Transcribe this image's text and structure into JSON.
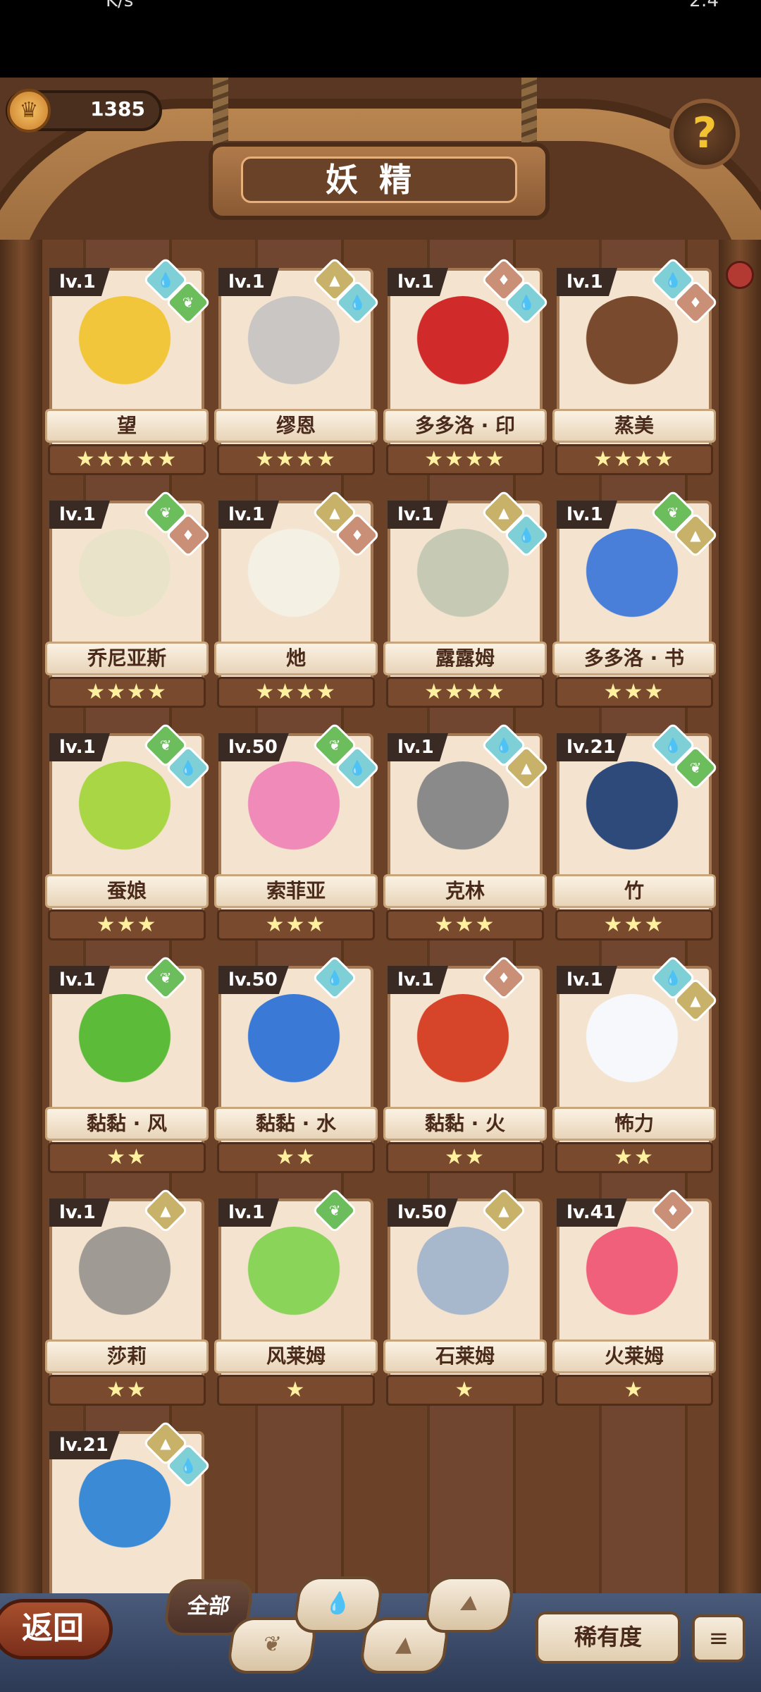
{
  "status": {
    "left": "K/s",
    "right": "2:4"
  },
  "header": {
    "coins": "1385",
    "title": "妖精",
    "help": "?"
  },
  "cards": [
    {
      "lv": "lv.1",
      "name": "望",
      "stars": "★★★★★",
      "elements": [
        "water",
        "wind"
      ],
      "color": "#f2c63b"
    },
    {
      "lv": "lv.1",
      "name": "缪恩",
      "stars": "★★★★",
      "elements": [
        "earth",
        "water"
      ],
      "color": "#c9c6c4"
    },
    {
      "lv": "lv.1",
      "name": "多多洛 · 印",
      "stars": "★★★★",
      "elements": [
        "fire",
        "water"
      ],
      "color": "#d12a2a"
    },
    {
      "lv": "lv.1",
      "name": "蒸美",
      "stars": "★★★★",
      "elements": [
        "water",
        "fire"
      ],
      "color": "#7a4a2e"
    },
    {
      "lv": "lv.1",
      "name": "乔尼亚斯",
      "stars": "★★★★",
      "elements": [
        "wind",
        "fire"
      ],
      "color": "#e9e3c9"
    },
    {
      "lv": "lv.1",
      "name": "灺",
      "stars": "★★★★",
      "elements": [
        "earth",
        "fire"
      ],
      "color": "#f4f0e4"
    },
    {
      "lv": "lv.1",
      "name": "露露姆",
      "stars": "★★★★",
      "elements": [
        "earth",
        "water"
      ],
      "color": "#c6cab4"
    },
    {
      "lv": "lv.1",
      "name": "多多洛 · 书",
      "stars": "★★★",
      "elements": [
        "wind",
        "earth"
      ],
      "color": "#4a7fd9"
    },
    {
      "lv": "lv.1",
      "name": "蚕娘",
      "stars": "★★★",
      "elements": [
        "wind",
        "water"
      ],
      "color": "#a9d645"
    },
    {
      "lv": "lv.50",
      "name": "索菲亚",
      "stars": "★★★",
      "elements": [
        "wind",
        "water"
      ],
      "color": "#f08ab8"
    },
    {
      "lv": "lv.1",
      "name": "克林",
      "stars": "★★★",
      "elements": [
        "water",
        "earth"
      ],
      "color": "#8a8a8a"
    },
    {
      "lv": "lv.21",
      "name": "竹",
      "stars": "★★★",
      "elements": [
        "water",
        "wind"
      ],
      "color": "#2d4a7a"
    },
    {
      "lv": "lv.1",
      "name": "黏黏 · 风",
      "stars": "★★",
      "elements": [
        "wind"
      ],
      "color": "#5cbc3a"
    },
    {
      "lv": "lv.50",
      "name": "黏黏 · 水",
      "stars": "★★",
      "elements": [
        "water"
      ],
      "color": "#3a7ad6"
    },
    {
      "lv": "lv.1",
      "name": "黏黏 · 火",
      "stars": "★★",
      "elements": [
        "fire"
      ],
      "color": "#d6442a"
    },
    {
      "lv": "lv.1",
      "name": "怖力",
      "stars": "★★",
      "elements": [
        "water",
        "earth"
      ],
      "color": "#f6f8fc"
    },
    {
      "lv": "lv.1",
      "name": "莎莉",
      "stars": "★★",
      "elements": [
        "earth"
      ],
      "color": "#a09a94"
    },
    {
      "lv": "lv.1",
      "name": "风莱姆",
      "stars": "★",
      "elements": [
        "wind"
      ],
      "color": "#8ad45a"
    },
    {
      "lv": "lv.50",
      "name": "石莱姆",
      "stars": "★",
      "elements": [
        "earth"
      ],
      "color": "#a8b8cc"
    },
    {
      "lv": "lv.41",
      "name": "火莱姆",
      "stars": "★",
      "elements": [
        "fire"
      ],
      "color": "#f0607a"
    },
    {
      "lv": "lv.21",
      "name": "",
      "stars": "",
      "elements": [
        "earth",
        "water"
      ],
      "color": "#3a8ad6"
    }
  ],
  "footer": {
    "back": "返回",
    "all": "全部",
    "rarity": "稀有度",
    "sort": "≡"
  }
}
